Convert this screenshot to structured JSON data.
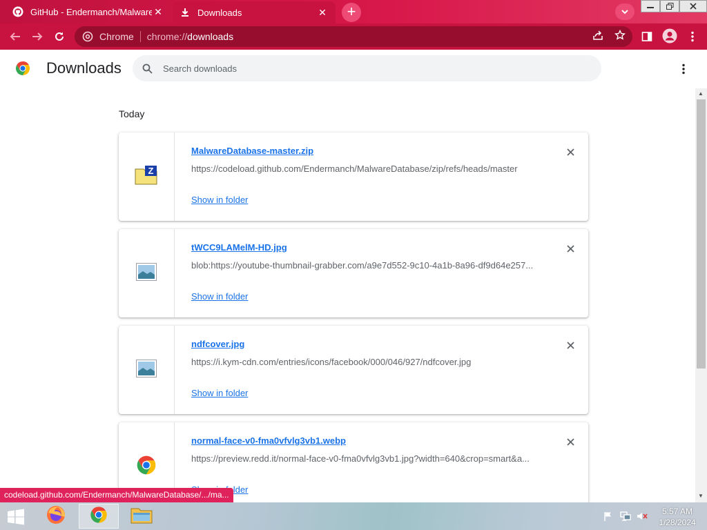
{
  "browser": {
    "tabs": [
      {
        "title": "GitHub - Endermanch/MalwareDatabase",
        "active": false,
        "icon": "github-icon"
      },
      {
        "title": "Downloads",
        "active": true,
        "icon": "download-icon"
      }
    ],
    "omnibox": {
      "chip": "Chrome",
      "url_scheme": "chrome://",
      "url_host": "downloads"
    }
  },
  "page": {
    "title": "Downloads",
    "search_placeholder": "Search downloads",
    "section": "Today"
  },
  "downloads": [
    {
      "name": "MalwareDatabase-master.zip",
      "url": "https://codeload.github.com/Endermanch/MalwareDatabase/zip/refs/heads/master",
      "action": "Show in folder",
      "icon": "zip-file-icon"
    },
    {
      "name": "tWCC9LAMelM-HD.jpg",
      "url": "blob:https://youtube-thumbnail-grabber.com/a9e7d552-9c10-4a1b-8a96-df9d64e257...",
      "action": "Show in folder",
      "icon": "image-file-icon"
    },
    {
      "name": "ndfcover.jpg",
      "url": "https://i.kym-cdn.com/entries/icons/facebook/000/046/927/ndfcover.jpg",
      "action": "Show in folder",
      "icon": "image-file-icon"
    },
    {
      "name": "normal-face-v0-fma0vfvlg3vb1.webp",
      "url": "https://preview.redd.it/normal-face-v0-fma0vfvlg3vb1.jpg?width=640&crop=smart&a...",
      "action": "Show in folder",
      "icon": "chrome-icon"
    }
  ],
  "status_bubble": "codeload.github.com/Endermanch/MalwareDatabase/.../ma...",
  "taskbar": {
    "time": "5:57 AM",
    "date": "1/28/2024"
  },
  "colors": {
    "accent": "#c8123f",
    "link": "#1a73e8",
    "status": "#e0225a"
  }
}
